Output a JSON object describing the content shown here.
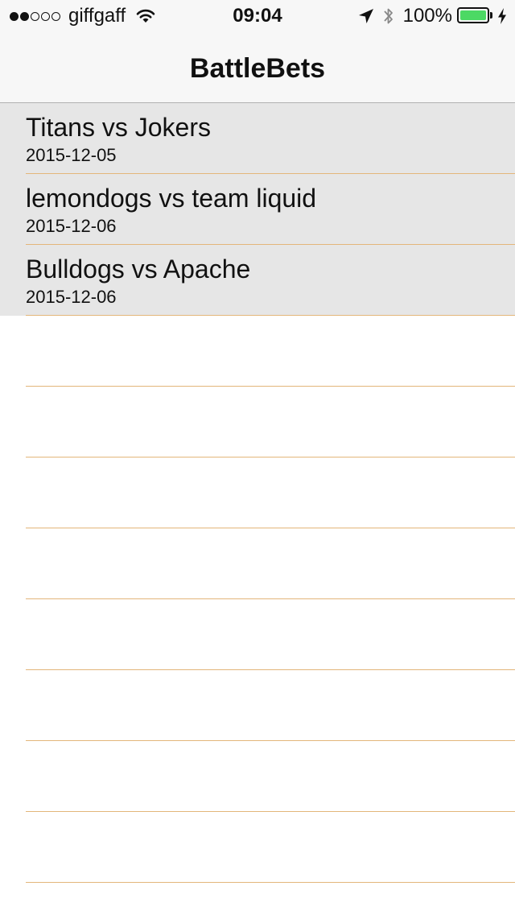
{
  "status_bar": {
    "signal_dots_filled": 2,
    "signal_dots_total": 5,
    "carrier": "giffgaff",
    "time": "09:04",
    "battery_percent": "100%",
    "battery_fill_fraction": 1.0,
    "battery_color": "#4cd964",
    "icons": [
      "wifi-icon",
      "location-arrow-icon",
      "bluetooth-icon",
      "battery-icon",
      "charging-bolt-icon"
    ]
  },
  "nav": {
    "title": "BattleBets"
  },
  "matches": [
    {
      "title": "Titans vs Jokers",
      "date": "2015-12-05"
    },
    {
      "title": "lemondogs vs team liquid",
      "date": "2015-12-06"
    },
    {
      "title": "Bulldogs vs Apache",
      "date": "2015-12-06"
    }
  ],
  "colors": {
    "separator": "#e3b67a",
    "filled_row_background": "#e6e6e6",
    "bar_background": "#f7f7f7"
  }
}
